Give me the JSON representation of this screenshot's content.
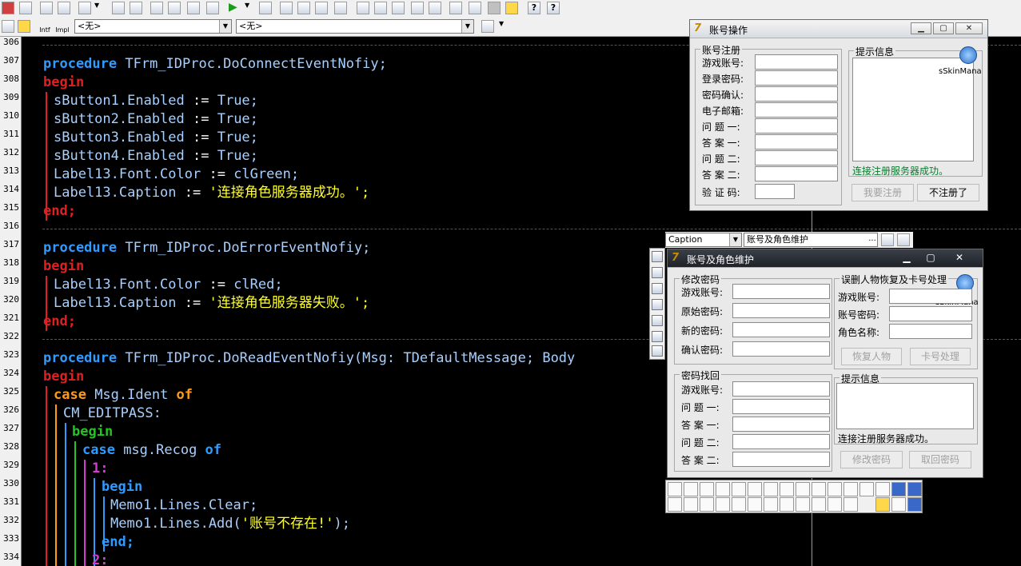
{
  "toolbar2": {
    "combo1": "<无>",
    "combo2": "<无>",
    "btn_intf": "Intf",
    "btn_impl": "Impl"
  },
  "gutter_lines": [
    "306",
    "307",
    "308",
    "309",
    "310",
    "311",
    "312",
    "313",
    "314",
    "315",
    "316",
    "317",
    "318",
    "319",
    "320",
    "321",
    "322",
    "323",
    "324",
    "325",
    "326",
    "327",
    "328",
    "329",
    "330",
    "331",
    "332",
    "333",
    "334"
  ],
  "code": {
    "l307_kw": "procedure",
    "l307_rest": " TFrm_IDProc.DoConnectEventNofiy;",
    "l308": "begin",
    "l309a": "sButton1.Enabled",
    "l309b": " := ",
    "l309c": "True;",
    "l310a": "sButton2.Enabled",
    "l310c": "True;",
    "l311a": "sButton3.Enabled",
    "l311c": "True;",
    "l312a": "sButton4.Enabled",
    "l312c": "True;",
    "l313a": "Label13.Font.Color",
    "l313c": "clGreen;",
    "l314a": "Label13.Caption",
    "l314c": "'连接角色服务器成功。';",
    "l315": "end;",
    "l317_kw": "procedure",
    "l317_rest": " TFrm_IDProc.DoErrorEventNofiy;",
    "l318": "begin",
    "l319a": "Label13.Font.Color",
    "l319c": "clRed;",
    "l320a": "Label13.Caption",
    "l320c": "'连接角色服务器失败。';",
    "l321": "end;",
    "l323_kw": "procedure",
    "l323_rest": " TFrm_IDProc.DoReadEventNofiy(Msg: TDefaultMessage; Body",
    "l324": "begin",
    "l325_kw": "case",
    "l325_mid": " Msg.Ident ",
    "l325_of": "of",
    "l326": "CM_EDITPASS:",
    "l327": "begin",
    "l328_kw": "case",
    "l328_mid": " msg.Recog ",
    "l328_of": "of",
    "l329": "1:",
    "l330": "begin",
    "l331": "Memo1.Lines.Clear;",
    "l332a": "Memo1.Lines.Add(",
    "l332b": "'账号不存在!'",
    "l332c": ");",
    "l333": "end;",
    "l334": "2:"
  },
  "win1": {
    "title": "账号操作",
    "group_register": "账号注册",
    "labels": [
      "游戏账号:",
      "登录密码:",
      "密码确认:",
      "电子邮箱:",
      "问 题 一:",
      "答 案 一:",
      "问 题 二:",
      "答 案 二:",
      "验 证 码:"
    ],
    "group_info": "提示信息",
    "skin": "sSkinMana",
    "status": "连接注册服务器成功。",
    "btn_register": "我要注册",
    "btn_cancel": "不注册了"
  },
  "objinsp": {
    "prop": "Caption",
    "value": "账号及角色维护",
    "ellipsis": "..."
  },
  "win2": {
    "title": "账号及角色维护",
    "group_modify": "修改密码",
    "modify_labels": [
      "游戏账号:",
      "原始密码:",
      "新的密码:",
      "确认密码:"
    ],
    "group_restore": "误删人物恢复及卡号处理",
    "restore_labels": [
      "游戏账号:",
      "账号密码:",
      "角色名称:"
    ],
    "skin": "sSkinMana",
    "btn_restore": "恢复人物",
    "btn_card": "卡号处理",
    "group_find": "密码找回",
    "find_labels": [
      "游戏账号:",
      "问 题 一:",
      "答 案 一:",
      "问 题 二:",
      "答 案 二:"
    ],
    "group_info": "提示信息",
    "status": "连接注册服务器成功。",
    "btn_modify": "修改密码",
    "btn_find": "取回密码"
  }
}
